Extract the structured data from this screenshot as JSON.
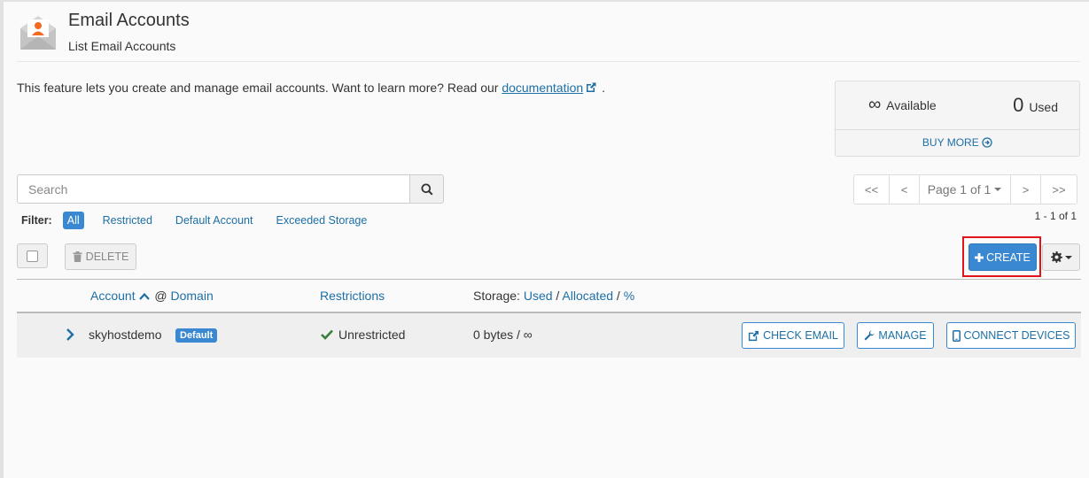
{
  "header": {
    "title": "Email Accounts",
    "subtitle": "List Email Accounts"
  },
  "intro": {
    "text": "This feature lets you create and manage email accounts. Want to learn more? Read our ",
    "link_label": "documentation",
    "suffix": "."
  },
  "stats": {
    "available_value": "∞",
    "available_label": "Available",
    "used_value": "0",
    "used_label": "Used",
    "buy_more_label": "BUY MORE"
  },
  "search": {
    "placeholder": "Search"
  },
  "filter": {
    "label": "Filter:",
    "options": [
      "All",
      "Restricted",
      "Default Account",
      "Exceeded Storage"
    ],
    "active": "All"
  },
  "pagination": {
    "first": "<<",
    "prev": "<",
    "page_label": "Page 1 of 1",
    "next": ">",
    "last": ">>",
    "range": "1 - 1 of 1"
  },
  "toolbar": {
    "delete_label": "DELETE",
    "create_label": "CREATE"
  },
  "table": {
    "headers": {
      "account": "Account",
      "at": "@",
      "domain": "Domain",
      "restrictions": "Restrictions",
      "storage_prefix": "Storage:",
      "storage_used": "Used",
      "storage_sep1": "/",
      "storage_allocated": "Allocated",
      "storage_sep2": "/",
      "storage_pct": "%"
    },
    "rows": [
      {
        "account": "skyhostdemo",
        "badge": "Default",
        "restriction": "Unrestricted",
        "storage": "0 bytes / ∞",
        "actions": {
          "check_email": "CHECK EMAIL",
          "manage": "MANAGE",
          "connect_devices": "CONNECT DEVICES"
        }
      }
    ]
  },
  "colors": {
    "accent": "#3a88d1",
    "link": "#1d6fa5",
    "highlight": "#e0141a",
    "success": "#3b7d3b",
    "logo_orange": "#f26b21"
  }
}
